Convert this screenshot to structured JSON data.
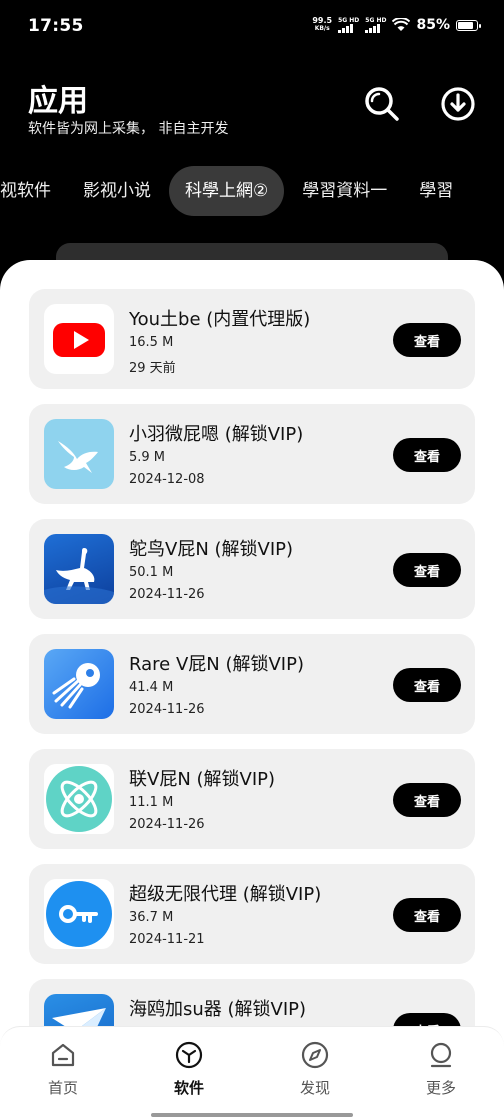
{
  "status_bar": {
    "time": "17:55",
    "net_speed_value": "99.5",
    "net_speed_unit": "KB/s",
    "sim1_label": "5G HD",
    "sim2_label": "5G HD",
    "battery_percent": "85%",
    "battery_level": 0.85
  },
  "header": {
    "title": "应用",
    "subtitle": "软件皆为网上采集， 非自主开发",
    "search_icon": "search-icon",
    "download_icon": "download-icon"
  },
  "tabs": [
    {
      "label": "视软件",
      "active": false
    },
    {
      "label": "影视小说",
      "active": false
    },
    {
      "label": "科學上網②",
      "active": true
    },
    {
      "label": "學習資料一",
      "active": false
    },
    {
      "label": "學習",
      "active": false
    }
  ],
  "apps": [
    {
      "name": "You土be (内置代理版)",
      "size": "16.5 M",
      "date": "29 天前",
      "button": "查看",
      "icon": "youtube-icon"
    },
    {
      "name": "小羽微屁嗯 (解锁VIP)",
      "size": "5.9 M",
      "date": "2024-12-08",
      "button": "查看",
      "icon": "bird-icon"
    },
    {
      "name": "鸵鸟V屁N (解锁VIP)",
      "size": "50.1 M",
      "date": "2024-11-26",
      "button": "查看",
      "icon": "ostrich-icon"
    },
    {
      "name": "Rare V屁N (解锁VIP)",
      "size": "41.4 M",
      "date": "2024-11-26",
      "button": "查看",
      "icon": "rocket-icon"
    },
    {
      "name": "联V屁N (解锁VIP)",
      "size": "11.1 M",
      "date": "2024-11-26",
      "button": "查看",
      "icon": "atom-icon"
    },
    {
      "name": "超级无限代理 (解锁VIP)",
      "size": "36.7 M",
      "date": "2024-11-21",
      "button": "查看",
      "icon": "key-icon"
    },
    {
      "name": "海鸥加su器 (解锁VIP)",
      "size": "",
      "date": "",
      "button": "查看",
      "icon": "plane-icon"
    }
  ],
  "bottom_nav": [
    {
      "label": "首页",
      "icon": "home-icon",
      "active": false
    },
    {
      "label": "软件",
      "icon": "cube-icon",
      "active": true
    },
    {
      "label": "发现",
      "icon": "compass-icon",
      "active": false
    },
    {
      "label": "更多",
      "icon": "more-icon",
      "active": false
    }
  ],
  "colors": {
    "background": "#000000",
    "panel": "#ffffff",
    "card": "#f0f0f0",
    "active_tab": "#3a3a3a",
    "button": "#000000"
  }
}
